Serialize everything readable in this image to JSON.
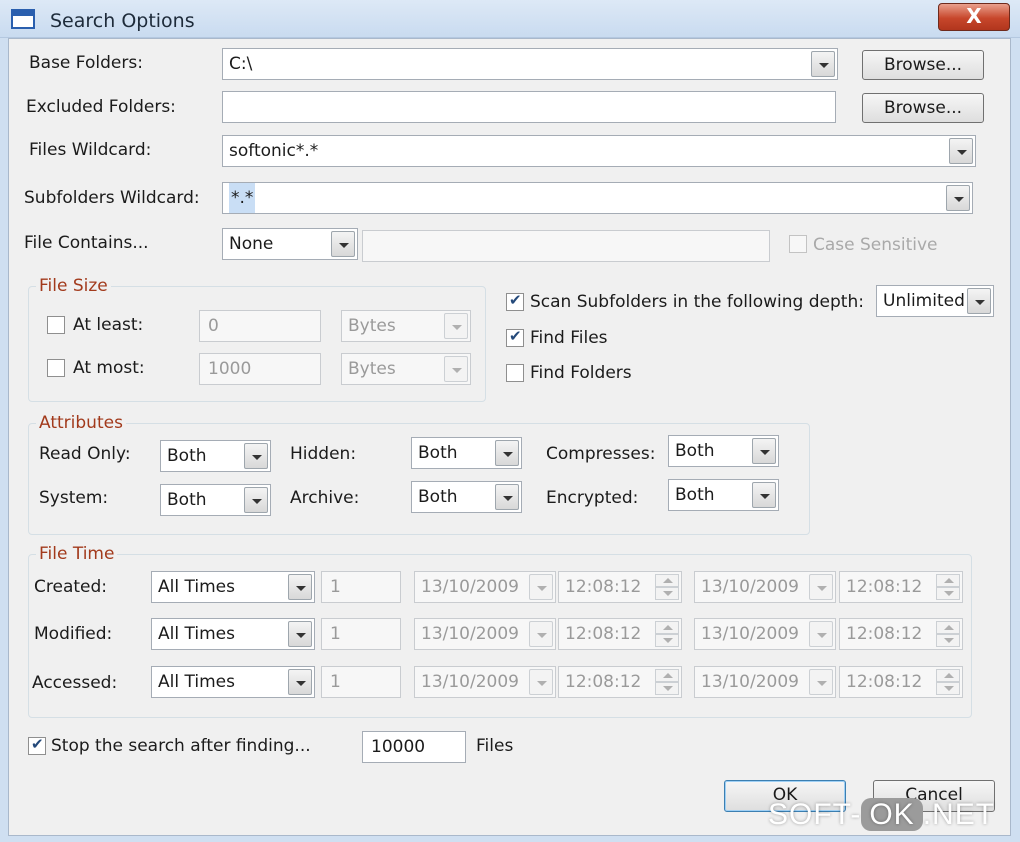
{
  "window": {
    "title": "Search Options",
    "close_glyph": "X"
  },
  "base_folders": {
    "label": "Base Folders:",
    "value": "C:\\",
    "browse": "Browse..."
  },
  "excluded_folders": {
    "label": "Excluded Folders:",
    "value": "",
    "browse": "Browse..."
  },
  "files_wildcard": {
    "label": "Files Wildcard:",
    "value": "softonic*.*"
  },
  "subfolders_wildcard": {
    "label": "Subfolders Wildcard:",
    "value": "*.*"
  },
  "file_contains": {
    "label": "File Contains...",
    "mode": "None",
    "text": "",
    "case_sensitive": "Case Sensitive"
  },
  "file_size": {
    "legend": "File Size",
    "at_least": {
      "label": "At least:",
      "value": "0",
      "unit": "Bytes",
      "checked": false
    },
    "at_most": {
      "label": "At most:",
      "value": "1000",
      "unit": "Bytes",
      "checked": false
    }
  },
  "scan": {
    "scan_subfolders": "Scan Subfolders in the following depth:",
    "depth": "Unlimited",
    "find_files": "Find Files",
    "find_folders": "Find Folders"
  },
  "attributes": {
    "legend": "Attributes",
    "read_only": {
      "label": "Read Only:",
      "value": "Both"
    },
    "hidden": {
      "label": "Hidden:",
      "value": "Both"
    },
    "compresses": {
      "label": "Compresses:",
      "value": "Both"
    },
    "system": {
      "label": "System:",
      "value": "Both"
    },
    "archive": {
      "label": "Archive:",
      "value": "Both"
    },
    "encrypted": {
      "label": "Encrypted:",
      "value": "Both"
    }
  },
  "file_time": {
    "legend": "File Time",
    "rows": [
      {
        "label": "Created:",
        "mode": "All Times",
        "num": "1",
        "date1": "13/10/2009",
        "time1": "12:08:12",
        "date2": "13/10/2009",
        "time2": "12:08:12"
      },
      {
        "label": "Modified:",
        "mode": "All Times",
        "num": "1",
        "date1": "13/10/2009",
        "time1": "12:08:12",
        "date2": "13/10/2009",
        "time2": "12:08:12"
      },
      {
        "label": "Accessed:",
        "mode": "All Times",
        "num": "1",
        "date1": "13/10/2009",
        "time1": "12:08:12",
        "date2": "13/10/2009",
        "time2": "12:08:12"
      }
    ]
  },
  "stop": {
    "label": "Stop the search after finding...",
    "value": "10000",
    "suffix": "Files"
  },
  "buttons": {
    "ok": "OK",
    "cancel": "Cancel"
  },
  "watermark": {
    "left": "SOFT-",
    "mid": "OK",
    "right": ".NET"
  },
  "colors": {
    "legend": "#a23a1c",
    "titlebar": "#c9dbf0",
    "close": "#c7462b",
    "dialog": "#f0f0f0"
  }
}
